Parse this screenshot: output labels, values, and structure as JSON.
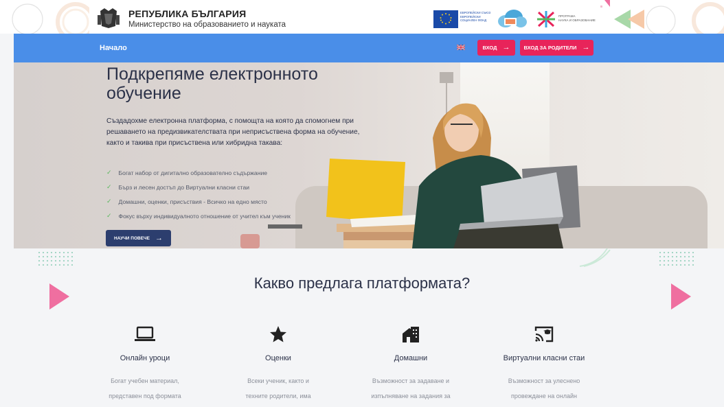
{
  "header": {
    "ministry_title": "РЕПУБЛИКА БЪЛГАРИЯ",
    "ministry_subtitle": "Министерство на образованието и науката",
    "eu_fund_text": "ЕВРОПЕЙСКИ СЪЮЗ ЕВРОПЕЙСКИ СОЦИАЛЕН ФОНД"
  },
  "nav": {
    "home": "Начало",
    "language_icon": "uk-flag-icon",
    "login": "ВХОД",
    "login_parents": "ВХОД ЗА РОДИТЕЛИ"
  },
  "hero": {
    "title": "Подкрепяме електронното обучение",
    "description": "Създадохме електронна платформа, с помощта на която да спомогнем при решаването на предизвикателствата при неприсъствена форма на обучение, както и такива при присъствена или хибридна такава:",
    "bullets": [
      "Богат набор от дигитално образователно съдържание",
      "Бърз и лесен достъп до Виртуални класни стаи",
      "Домашни, оценки, присъствия - Всичко на едно място",
      "Фокус върху индивидуалното отношение от учител към ученик"
    ],
    "more_button": "НАУЧИ ПОВЕЧЕ"
  },
  "offers": {
    "title": "Какво предлага платформата?",
    "features": [
      {
        "icon": "laptop-icon",
        "name": "Онлайн уроци",
        "desc1": "Богат учебен материал,",
        "desc2": "представен под формата"
      },
      {
        "icon": "star-icon",
        "name": "Оценки",
        "desc1": "Всеки ученик, както и",
        "desc2": "техните родители, има"
      },
      {
        "icon": "house-icon",
        "name": "Домашни",
        "desc1": "Възможност за задаване и",
        "desc2": "изпълняване на задания за"
      },
      {
        "icon": "cast-classroom-icon",
        "name": "Виртуални класни стаи",
        "desc1": "Възможност за улеснено",
        "desc2": "провеждане на онлайн"
      }
    ]
  },
  "colors": {
    "nav_blue": "#4a8ee8",
    "accent_pink": "#e8245a",
    "dark_navy": "#2c3e6e",
    "check_green": "#58b85c"
  }
}
